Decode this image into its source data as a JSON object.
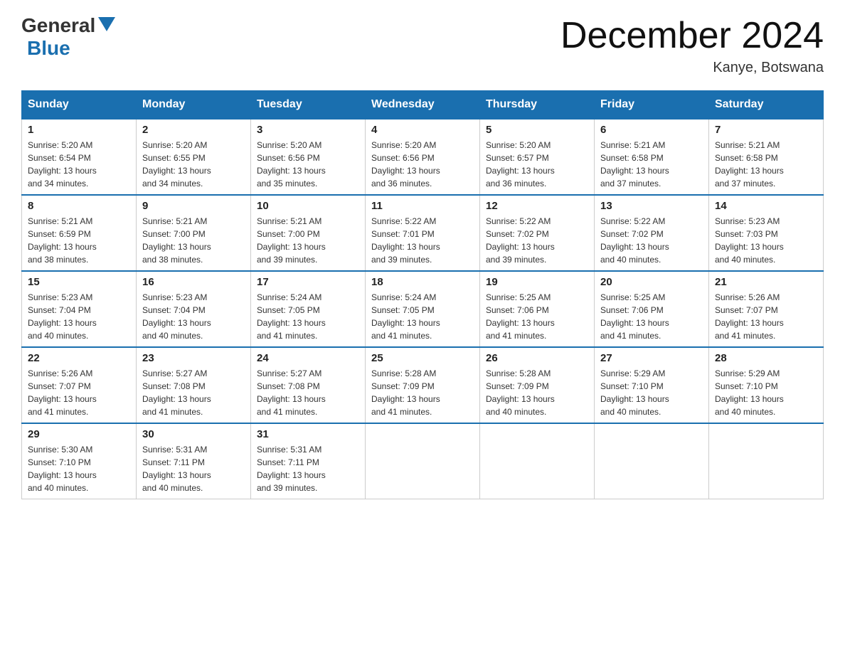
{
  "logo": {
    "general": "General",
    "blue": "Blue"
  },
  "title": "December 2024",
  "location": "Kanye, Botswana",
  "headers": [
    "Sunday",
    "Monday",
    "Tuesday",
    "Wednesday",
    "Thursday",
    "Friday",
    "Saturday"
  ],
  "weeks": [
    [
      {
        "day": "1",
        "sunrise": "5:20 AM",
        "sunset": "6:54 PM",
        "daylight": "13 hours and 34 minutes."
      },
      {
        "day": "2",
        "sunrise": "5:20 AM",
        "sunset": "6:55 PM",
        "daylight": "13 hours and 34 minutes."
      },
      {
        "day": "3",
        "sunrise": "5:20 AM",
        "sunset": "6:56 PM",
        "daylight": "13 hours and 35 minutes."
      },
      {
        "day": "4",
        "sunrise": "5:20 AM",
        "sunset": "6:56 PM",
        "daylight": "13 hours and 36 minutes."
      },
      {
        "day": "5",
        "sunrise": "5:20 AM",
        "sunset": "6:57 PM",
        "daylight": "13 hours and 36 minutes."
      },
      {
        "day": "6",
        "sunrise": "5:21 AM",
        "sunset": "6:58 PM",
        "daylight": "13 hours and 37 minutes."
      },
      {
        "day": "7",
        "sunrise": "5:21 AM",
        "sunset": "6:58 PM",
        "daylight": "13 hours and 37 minutes."
      }
    ],
    [
      {
        "day": "8",
        "sunrise": "5:21 AM",
        "sunset": "6:59 PM",
        "daylight": "13 hours and 38 minutes."
      },
      {
        "day": "9",
        "sunrise": "5:21 AM",
        "sunset": "7:00 PM",
        "daylight": "13 hours and 38 minutes."
      },
      {
        "day": "10",
        "sunrise": "5:21 AM",
        "sunset": "7:00 PM",
        "daylight": "13 hours and 39 minutes."
      },
      {
        "day": "11",
        "sunrise": "5:22 AM",
        "sunset": "7:01 PM",
        "daylight": "13 hours and 39 minutes."
      },
      {
        "day": "12",
        "sunrise": "5:22 AM",
        "sunset": "7:02 PM",
        "daylight": "13 hours and 39 minutes."
      },
      {
        "day": "13",
        "sunrise": "5:22 AM",
        "sunset": "7:02 PM",
        "daylight": "13 hours and 40 minutes."
      },
      {
        "day": "14",
        "sunrise": "5:23 AM",
        "sunset": "7:03 PM",
        "daylight": "13 hours and 40 minutes."
      }
    ],
    [
      {
        "day": "15",
        "sunrise": "5:23 AM",
        "sunset": "7:04 PM",
        "daylight": "13 hours and 40 minutes."
      },
      {
        "day": "16",
        "sunrise": "5:23 AM",
        "sunset": "7:04 PM",
        "daylight": "13 hours and 40 minutes."
      },
      {
        "day": "17",
        "sunrise": "5:24 AM",
        "sunset": "7:05 PM",
        "daylight": "13 hours and 41 minutes."
      },
      {
        "day": "18",
        "sunrise": "5:24 AM",
        "sunset": "7:05 PM",
        "daylight": "13 hours and 41 minutes."
      },
      {
        "day": "19",
        "sunrise": "5:25 AM",
        "sunset": "7:06 PM",
        "daylight": "13 hours and 41 minutes."
      },
      {
        "day": "20",
        "sunrise": "5:25 AM",
        "sunset": "7:06 PM",
        "daylight": "13 hours and 41 minutes."
      },
      {
        "day": "21",
        "sunrise": "5:26 AM",
        "sunset": "7:07 PM",
        "daylight": "13 hours and 41 minutes."
      }
    ],
    [
      {
        "day": "22",
        "sunrise": "5:26 AM",
        "sunset": "7:07 PM",
        "daylight": "13 hours and 41 minutes."
      },
      {
        "day": "23",
        "sunrise": "5:27 AM",
        "sunset": "7:08 PM",
        "daylight": "13 hours and 41 minutes."
      },
      {
        "day": "24",
        "sunrise": "5:27 AM",
        "sunset": "7:08 PM",
        "daylight": "13 hours and 41 minutes."
      },
      {
        "day": "25",
        "sunrise": "5:28 AM",
        "sunset": "7:09 PM",
        "daylight": "13 hours and 41 minutes."
      },
      {
        "day": "26",
        "sunrise": "5:28 AM",
        "sunset": "7:09 PM",
        "daylight": "13 hours and 40 minutes."
      },
      {
        "day": "27",
        "sunrise": "5:29 AM",
        "sunset": "7:10 PM",
        "daylight": "13 hours and 40 minutes."
      },
      {
        "day": "28",
        "sunrise": "5:29 AM",
        "sunset": "7:10 PM",
        "daylight": "13 hours and 40 minutes."
      }
    ],
    [
      {
        "day": "29",
        "sunrise": "5:30 AM",
        "sunset": "7:10 PM",
        "daylight": "13 hours and 40 minutes."
      },
      {
        "day": "30",
        "sunrise": "5:31 AM",
        "sunset": "7:11 PM",
        "daylight": "13 hours and 40 minutes."
      },
      {
        "day": "31",
        "sunrise": "5:31 AM",
        "sunset": "7:11 PM",
        "daylight": "13 hours and 39 minutes."
      },
      null,
      null,
      null,
      null
    ]
  ],
  "labels": {
    "sunrise_prefix": "Sunrise: ",
    "sunset_prefix": "Sunset: ",
    "daylight_prefix": "Daylight: "
  }
}
